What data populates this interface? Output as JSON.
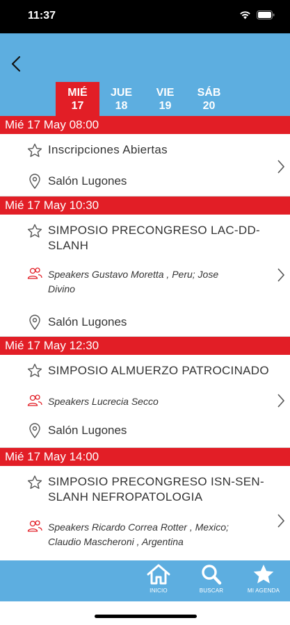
{
  "status_bar": {
    "time": "11:37"
  },
  "day_tabs": [
    {
      "day": "MIÉ",
      "date": "17"
    },
    {
      "day": "JUE",
      "date": "18"
    },
    {
      "day": "VIE",
      "date": "19"
    },
    {
      "day": "SÁB",
      "date": "20"
    }
  ],
  "slots": [
    {
      "header": "Mié 17 May 08:00",
      "title": "Inscripciones Abiertas",
      "room": "Salón Lugones"
    },
    {
      "header": "Mié 17 May 10:30",
      "title_line1": "SIMPOSIO PRECONGRESO LAC-DD-",
      "title_line2": "SLANH",
      "speakers_line1": "Speakers Gustavo Moretta , Peru; Jose",
      "speakers_line2": "Divino",
      "room": "Salón Lugones"
    },
    {
      "header": "Mié 17 May 12:30",
      "title": "SIMPOSIO ALMUERZO PATROCINADO",
      "speakers": "Speakers Lucrecia Secco",
      "room": "Salón Lugones"
    },
    {
      "header": "Mié 17 May 14:00",
      "title_line1": "SIMPOSIO PRECONGRESO ISN-SEN-",
      "title_line2": "SLANH NEFROPATOLOGIA",
      "speakers_line1": "Speakers Ricardo Correa Rotter , Mexico;",
      "speakers_line2": "Claudio Mascheroni , Argentina"
    }
  ],
  "bottom_nav": {
    "home": "INICIO",
    "search": "BUSCAR",
    "agenda": "MI AGENDA"
  },
  "colors": {
    "header_blue": "#5daee0",
    "accent_red": "#e21e26"
  },
  "icons": [
    "back-icon",
    "star-outline-icon",
    "location-pin-icon",
    "speakers-icon",
    "chevron-right-icon",
    "home-icon",
    "search-icon",
    "star-icon"
  ]
}
